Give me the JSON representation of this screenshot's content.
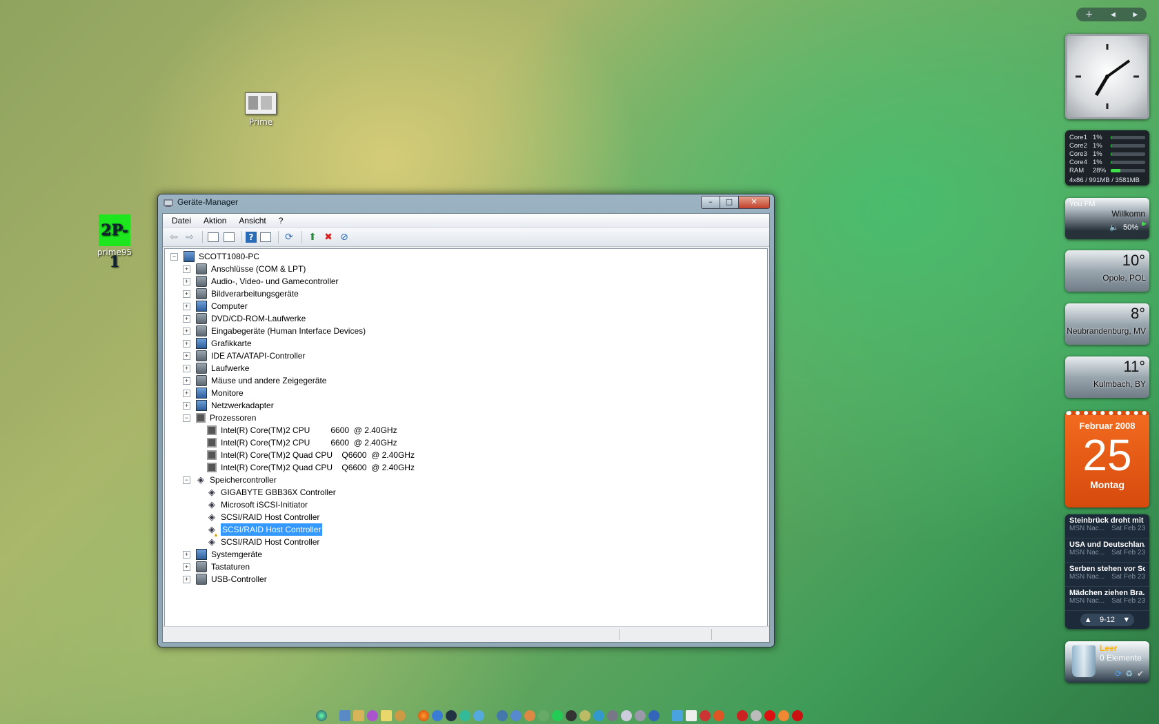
{
  "desktop": {
    "icons": [
      {
        "label": "Prime"
      },
      {
        "label": "prime95",
        "glyph": "2P-1"
      }
    ]
  },
  "window": {
    "title": "Geräte-Manager",
    "controls": {
      "minimize": "–",
      "maximize": "□",
      "close": "✕"
    },
    "menu": [
      "Datei",
      "Aktion",
      "Ansicht",
      "?"
    ],
    "toolbar_icons": [
      "back-icon",
      "forward-icon",
      "show-hide-tree-icon",
      "properties-icon",
      "help-icon",
      "view-icon",
      "scan-hardware-icon",
      "update-driver-icon",
      "uninstall-icon",
      "disable-icon"
    ],
    "tree": {
      "root": "SCOTT1080-PC",
      "nodes": [
        {
          "label": "Anschlüsse (COM & LPT)",
          "expanded": false
        },
        {
          "label": "Audio-, Video- und Gamecontroller",
          "expanded": false
        },
        {
          "label": "Bildverarbeitungsgeräte",
          "expanded": false
        },
        {
          "label": "Computer",
          "expanded": false
        },
        {
          "label": "DVD/CD-ROM-Laufwerke",
          "expanded": false
        },
        {
          "label": "Eingabegeräte (Human Interface Devices)",
          "expanded": false
        },
        {
          "label": "Grafikkarte",
          "expanded": false
        },
        {
          "label": "IDE ATA/ATAPI-Controller",
          "expanded": false
        },
        {
          "label": "Laufwerke",
          "expanded": false
        },
        {
          "label": "Mäuse und andere Zeigegeräte",
          "expanded": false
        },
        {
          "label": "Monitore",
          "expanded": false
        },
        {
          "label": "Netzwerkadapter",
          "expanded": false
        },
        {
          "label": "Prozessoren",
          "expanded": true,
          "children": [
            "Intel(R) Core(TM)2 CPU         6600  @ 2.40GHz",
            "Intel(R) Core(TM)2 CPU         6600  @ 2.40GHz",
            "Intel(R) Core(TM)2 Quad CPU    Q6600  @ 2.40GHz",
            "Intel(R) Core(TM)2 Quad CPU    Q6600  @ 2.40GHz"
          ]
        },
        {
          "label": "Speichercontroller",
          "expanded": true,
          "children": [
            "GIGABYTE GBB36X Controller",
            "Microsoft iSCSI-Initiator",
            "SCSI/RAID Host Controller",
            "SCSI/RAID Host Controller",
            "SCSI/RAID Host Controller"
          ]
        },
        {
          "label": "Systemgeräte",
          "expanded": false
        },
        {
          "label": "Tastaturen",
          "expanded": false
        },
        {
          "label": "USB-Controller",
          "expanded": false
        }
      ],
      "selected": "SCSI/RAID Host Controller"
    }
  },
  "sidebar": {
    "top_controls": [
      "+",
      "◂",
      "▸"
    ],
    "cpu_meter": {
      "rows": [
        {
          "name": "Core1",
          "value": "1%",
          "level": 0.01
        },
        {
          "name": "Core2",
          "value": "1%",
          "level": 0.01
        },
        {
          "name": "Core3",
          "value": "1%",
          "level": 0.01
        },
        {
          "name": "Core4",
          "value": "1%",
          "level": 0.01
        },
        {
          "name": "RAM",
          "value": "28%",
          "level": 0.28
        }
      ],
      "footer": "4x86 / 991MB / 3581MB"
    },
    "radio": {
      "station": "You FM",
      "status": "Willkomn",
      "volume": "50%"
    },
    "weather": [
      {
        "temp": "10°",
        "city": "Opole, POL"
      },
      {
        "temp": "8°",
        "city": "Neubrandenburg, MV"
      },
      {
        "temp": "11°",
        "city": "Kulmbach, BY"
      }
    ],
    "calendar": {
      "month": "Februar 2008",
      "day": "25",
      "weekday": "Montag"
    },
    "news": {
      "items": [
        {
          "headline": "Steinbrück droht mit ...",
          "source": "MSN Nac...",
          "date": "Sat Feb 23"
        },
        {
          "headline": "USA und Deutschlan...",
          "source": "MSN Nac...",
          "date": "Sat Feb 23"
        },
        {
          "headline": "Serben stehen vor Sc...",
          "source": "MSN Nac...",
          "date": "Sat Feb 23"
        },
        {
          "headline": "Mädchen ziehen Bra...",
          "source": "MSN Nac...",
          "date": "Sat Feb 23"
        }
      ],
      "range": "9-12"
    },
    "recycle_bin": {
      "status": "Leer",
      "count": "0 Elemente"
    }
  },
  "colors": {
    "selection": "#3399ff",
    "calendar": "#e85a14",
    "cpu_bar": "#3ee04a"
  }
}
